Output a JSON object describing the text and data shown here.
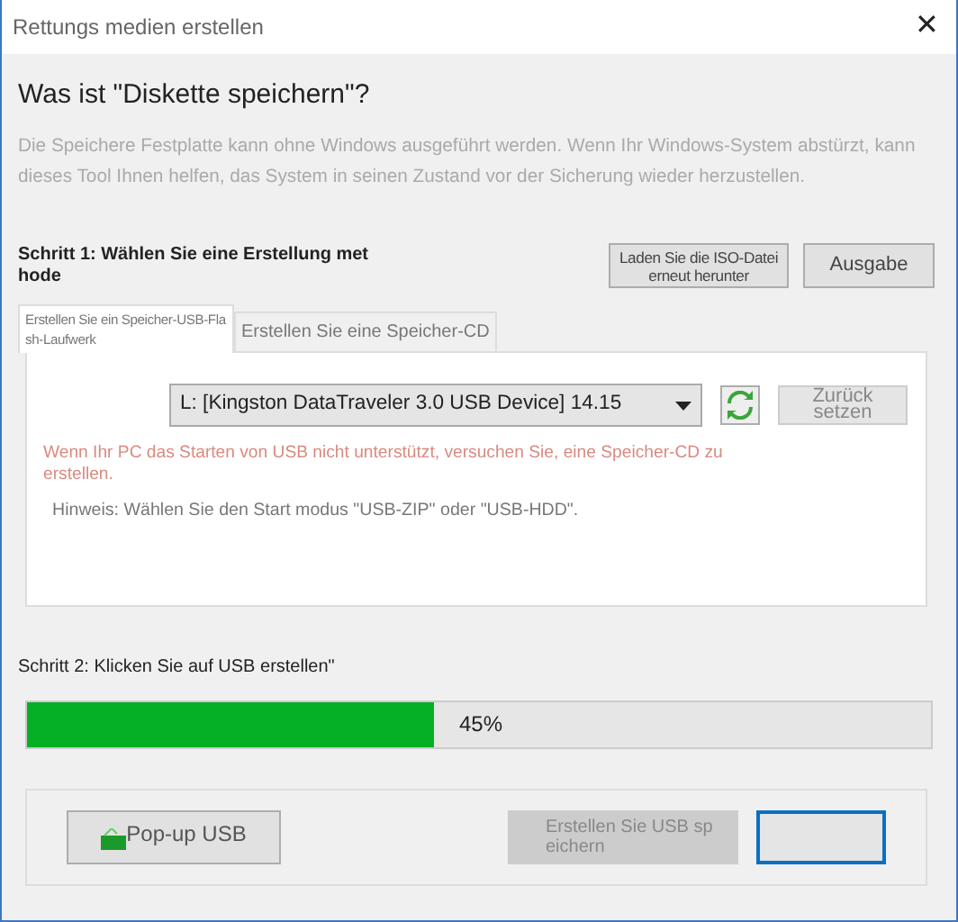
{
  "window": {
    "title": "Rettungs medien erstellen",
    "close": "✕"
  },
  "heading": "Was ist \"Diskette speichern\"?",
  "description": "Die Speichere Festplatte kann ohne Windows ausgeführt werden. Wenn Ihr Windows-System abstürzt, kann dieses Tool Ihnen helfen, das System in seinen Zustand vor der Sicherung wieder herzustellen.",
  "step1": {
    "label": "Schritt 1: Wählen Sie eine Erstellung methode",
    "buttons": [
      {
        "label": "Laden Sie die ISO-Datei erneut herunter",
        "disabled": false
      },
      {
        "label": "Ausgabe",
        "disabled": false
      }
    ]
  },
  "tabs": [
    {
      "label": "Erstellen Sie ein Speicher-USB-Flash-Laufwerk",
      "selected": true
    },
    {
      "label": "Erstellen Sie eine Speicher-CD",
      "selected": false
    }
  ],
  "usb": {
    "device": "L: [Kingston DataTraveler 3.0 USB Device] 14.15",
    "reset": {
      "label": "Zurück setzen",
      "disabled": true
    },
    "warning": "Wenn Ihr PC das Starten von USB nicht unterstützt, versuchen Sie, eine Speicher-CD zu erstellen.",
    "hint": "Hinweis: Wählen Sie den Start modus \"USB-ZIP\" oder \"USB-HDD\"."
  },
  "step2": {
    "label": "Schritt 2: Klicken Sie auf USB erstellen\"",
    "level": 0.45,
    "reading": "45%"
  },
  "footer": [
    {
      "label": "Pop-up USB",
      "disabled": false,
      "focused": false,
      "icon": true
    },
    {
      "label": "Erstellen Sie USB speichern",
      "disabled": true,
      "focused": false
    },
    {
      "disabled": false,
      "focused": true
    }
  ]
}
